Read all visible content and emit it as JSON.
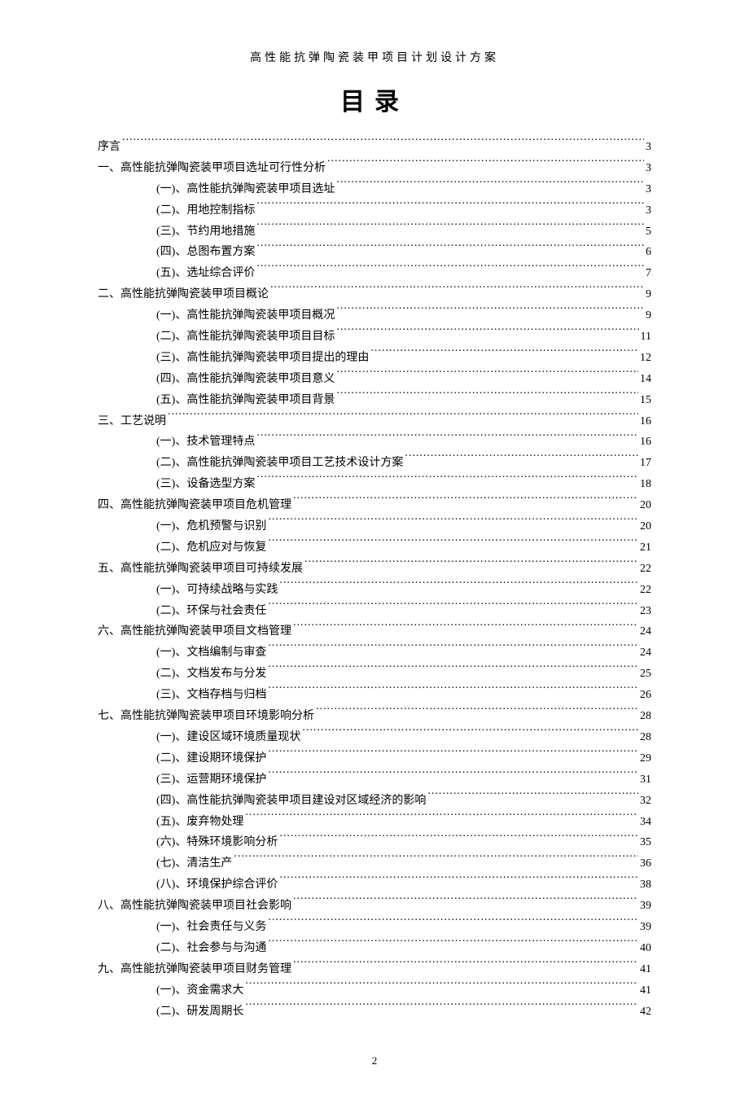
{
  "header": "高性能抗弹陶瓷装甲项目计划设计方案",
  "title": "目录",
  "page_number": "2",
  "toc": [
    {
      "level": 0,
      "label": "序言",
      "page": "3"
    },
    {
      "level": 0,
      "label": "一、高性能抗弹陶瓷装甲项目选址可行性分析",
      "page": "3"
    },
    {
      "level": 1,
      "label": "(一)、高性能抗弹陶瓷装甲项目选址",
      "page": "3"
    },
    {
      "level": 1,
      "label": "(二)、用地控制指标",
      "page": "3"
    },
    {
      "level": 1,
      "label": "(三)、节约用地措施",
      "page": "5"
    },
    {
      "level": 1,
      "label": "(四)、总图布置方案",
      "page": "6"
    },
    {
      "level": 1,
      "label": "(五)、选址综合评价",
      "page": "7"
    },
    {
      "level": 0,
      "label": "二、高性能抗弹陶瓷装甲项目概论",
      "page": "9"
    },
    {
      "level": 1,
      "label": "(一)、高性能抗弹陶瓷装甲项目概况",
      "page": "9"
    },
    {
      "level": 1,
      "label": "(二)、高性能抗弹陶瓷装甲项目目标",
      "page": "11"
    },
    {
      "level": 1,
      "label": "(三)、高性能抗弹陶瓷装甲项目提出的理由",
      "page": "12"
    },
    {
      "level": 1,
      "label": "(四)、高性能抗弹陶瓷装甲项目意义",
      "page": "14"
    },
    {
      "level": 1,
      "label": "(五)、高性能抗弹陶瓷装甲项目背景",
      "page": "15"
    },
    {
      "level": 0,
      "label": "三、工艺说明",
      "page": "16"
    },
    {
      "level": 1,
      "label": "(一)、技术管理特点",
      "page": "16"
    },
    {
      "level": 1,
      "label": "(二)、高性能抗弹陶瓷装甲项目工艺技术设计方案",
      "page": "17"
    },
    {
      "level": 1,
      "label": "(三)、设备选型方案",
      "page": "18"
    },
    {
      "level": 0,
      "label": "四、高性能抗弹陶瓷装甲项目危机管理",
      "page": "20"
    },
    {
      "level": 1,
      "label": "(一)、危机预警与识别",
      "page": "20"
    },
    {
      "level": 1,
      "label": "(二)、危机应对与恢复",
      "page": "21"
    },
    {
      "level": 0,
      "label": "五、高性能抗弹陶瓷装甲项目可持续发展",
      "page": "22"
    },
    {
      "level": 1,
      "label": "(一)、可持续战略与实践",
      "page": "22"
    },
    {
      "level": 1,
      "label": "(二)、环保与社会责任",
      "page": "23"
    },
    {
      "level": 0,
      "label": "六、高性能抗弹陶瓷装甲项目文档管理",
      "page": "24"
    },
    {
      "level": 1,
      "label": "(一)、文档编制与审查",
      "page": "24"
    },
    {
      "level": 1,
      "label": "(二)、文档发布与分发",
      "page": "25"
    },
    {
      "level": 1,
      "label": "(三)、文档存档与归档",
      "page": "26"
    },
    {
      "level": 0,
      "label": "七、高性能抗弹陶瓷装甲项目环境影响分析",
      "page": "28"
    },
    {
      "level": 1,
      "label": "(一)、建设区域环境质量现状",
      "page": "28"
    },
    {
      "level": 1,
      "label": "(二)、建设期环境保护",
      "page": "29"
    },
    {
      "level": 1,
      "label": "(三)、运营期环境保护",
      "page": "31"
    },
    {
      "level": 1,
      "label": "(四)、高性能抗弹陶瓷装甲项目建设对区域经济的影响",
      "page": "32"
    },
    {
      "level": 1,
      "label": "(五)、废弃物处理",
      "page": "34"
    },
    {
      "level": 1,
      "label": "(六)、特殊环境影响分析",
      "page": "35"
    },
    {
      "level": 1,
      "label": "(七)、清洁生产",
      "page": "36"
    },
    {
      "level": 1,
      "label": "(八)、环境保护综合评价",
      "page": "38"
    },
    {
      "level": 0,
      "label": "八、高性能抗弹陶瓷装甲项目社会影响",
      "page": "39"
    },
    {
      "level": 1,
      "label": "(一)、社会责任与义务",
      "page": "39"
    },
    {
      "level": 1,
      "label": "(二)、社会参与与沟通",
      "page": "40"
    },
    {
      "level": 0,
      "label": "九、高性能抗弹陶瓷装甲项目财务管理",
      "page": "41"
    },
    {
      "level": 1,
      "label": "(一)、资金需求大",
      "page": "41"
    },
    {
      "level": 1,
      "label": "(二)、研发周期长",
      "page": "42"
    }
  ]
}
